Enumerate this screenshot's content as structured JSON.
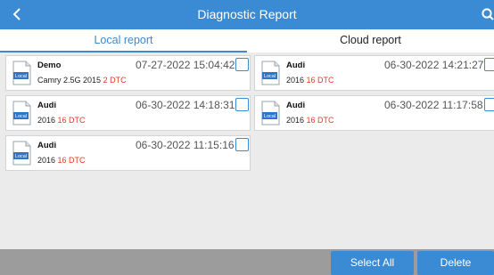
{
  "header": {
    "title": "Diagnostic Report",
    "back_icon": "chevron-left-icon",
    "search_icon": "search-icon"
  },
  "tabs": [
    {
      "label": "Local report",
      "active": true
    },
    {
      "label": "Cloud report",
      "active": false
    }
  ],
  "reports": [
    {
      "icon_text": "Local",
      "brand": "Demo",
      "date": "07-27-2022 15:04:42",
      "vehicle": "Camry 2.5G 2015",
      "dtc_count": "2 DTC",
      "checked": false
    },
    {
      "icon_text": "Local",
      "brand": "Audi",
      "date": "06-30-2022 14:21:27",
      "vehicle": "2016",
      "dtc_count": "16 DTC",
      "checked": false
    },
    {
      "icon_text": "Local",
      "brand": "Audi",
      "date": "06-30-2022 14:18:31",
      "vehicle": "2016",
      "dtc_count": "16 DTC",
      "checked": false
    },
    {
      "icon_text": "Local",
      "brand": "Audi",
      "date": "06-30-2022 11:17:58",
      "vehicle": "2016",
      "dtc_count": "16 DTC",
      "checked": false
    },
    {
      "icon_text": "Local",
      "brand": "Audi",
      "date": "06-30-2022 11:15:16",
      "vehicle": "2016",
      "dtc_count": "16 DTC",
      "checked": false
    }
  ],
  "footer": {
    "select_all_label": "Select All",
    "delete_label": "Delete"
  },
  "colors": {
    "accent": "#3a8ad4",
    "dtc_red": "#e23a2a",
    "background": "#ebebeb",
    "footer_bar": "#9c9c9c"
  }
}
